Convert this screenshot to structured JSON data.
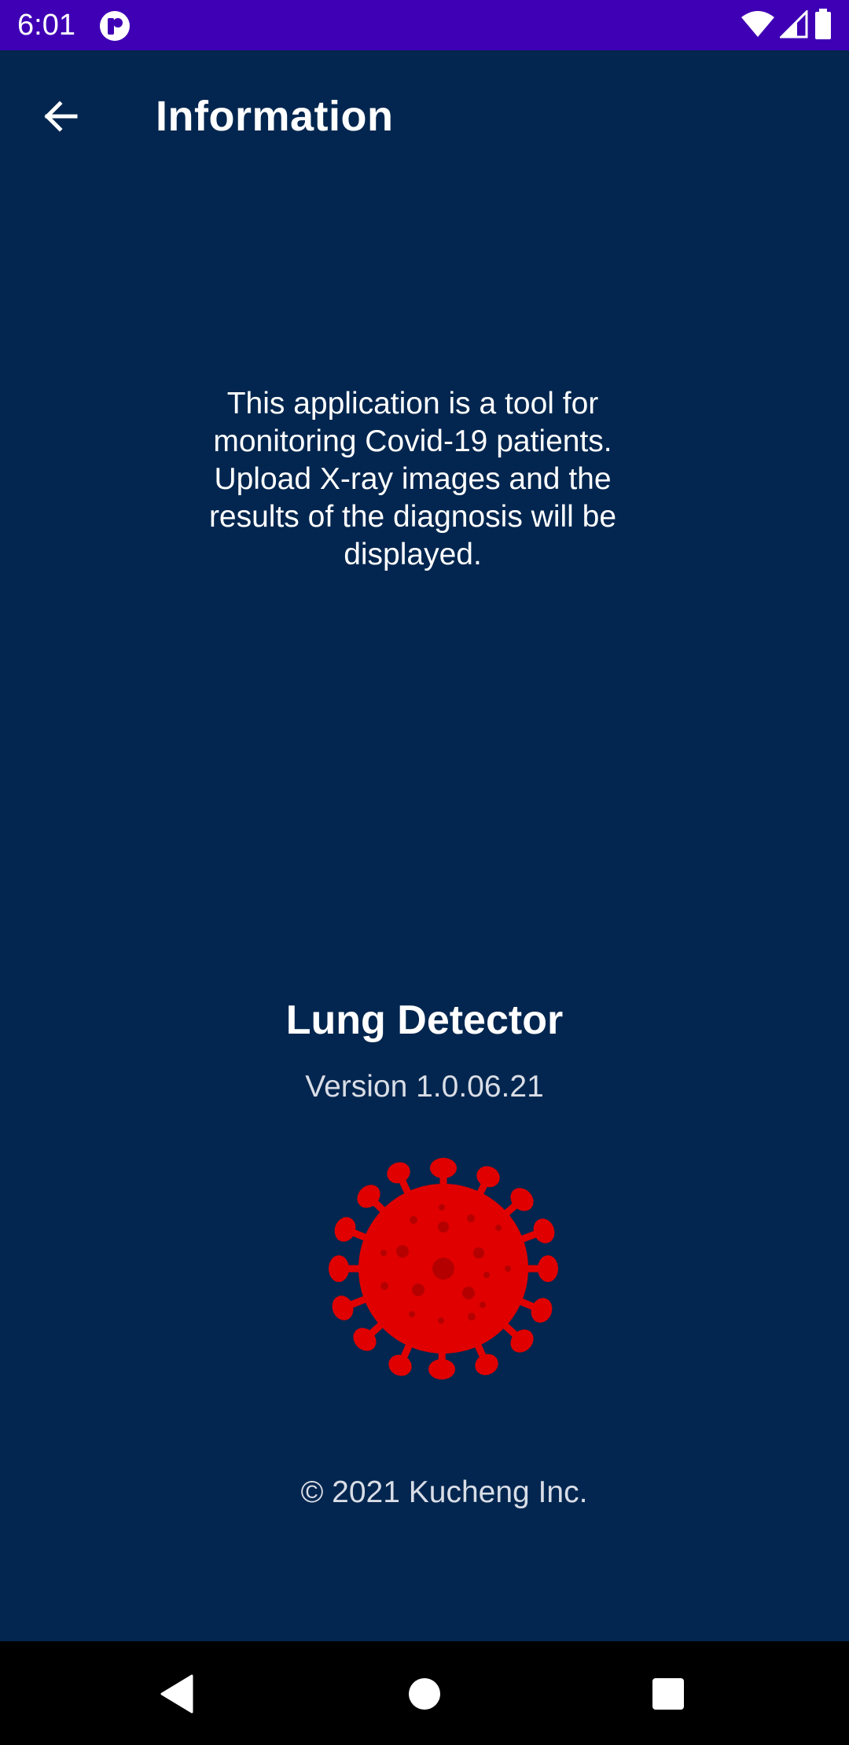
{
  "status_bar": {
    "time": "6:01",
    "background_color": "#3f00b5",
    "icons": [
      "app-notification-icon",
      "wifi-icon",
      "signal-icon",
      "battery-icon"
    ]
  },
  "toolbar": {
    "title": "Information",
    "back_icon": "arrow-left-icon"
  },
  "main": {
    "description": "This application is a tool for monitoring Covid-19 patients. Upload X-ray images and the results of the diagnosis will be displayed.",
    "app_name": "Lung Detector",
    "version": "Version 1.0.06.21",
    "logo_icon": "virus-icon",
    "logo_color": "#e00000",
    "copyright": "© 2021 Kucheng Inc."
  },
  "nav_bar": {
    "buttons": [
      "back-triangle-icon",
      "home-circle-icon",
      "recents-square-icon"
    ]
  },
  "colors": {
    "background": "#02264f",
    "text": "#ffffff",
    "secondary_text": "#d9dde6"
  }
}
